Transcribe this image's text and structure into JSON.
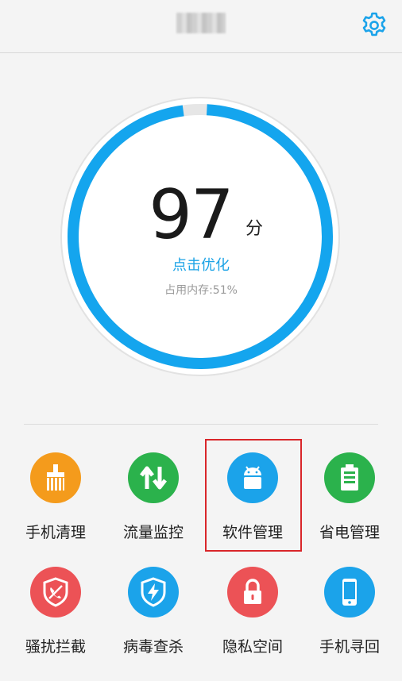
{
  "header": {
    "title": "▒▒▒▒",
    "settings_icon": "gear-icon"
  },
  "score": {
    "value": "97",
    "unit": "分",
    "action_label": "点击优化",
    "memory_text": "占用内存:51%",
    "ring_fraction": 0.97,
    "ring_color": "#14a5ee",
    "track_color": "#e2e2e2"
  },
  "tools_row1": [
    {
      "label": "手机清理",
      "icon": "broom-icon",
      "color": "#f49b1c"
    },
    {
      "label": "流量监控",
      "icon": "up-down-arrows-icon",
      "color": "#2bb24c"
    },
    {
      "label": "软件管理",
      "icon": "android-icon",
      "color": "#1ba3ea"
    },
    {
      "label": "省电管理",
      "icon": "battery-icon",
      "color": "#2bb24c"
    }
  ],
  "tools_row2": [
    {
      "label": "骚扰拦截",
      "icon": "blocked-call-icon",
      "color": "#ec5256"
    },
    {
      "label": "病毒查杀",
      "icon": "shield-lightning-icon",
      "color": "#1ba3ea"
    },
    {
      "label": "隐私空间",
      "icon": "lock-icon",
      "color": "#ec5256"
    },
    {
      "label": "手机寻回",
      "icon": "phone-icon",
      "color": "#1ba3ea"
    }
  ]
}
